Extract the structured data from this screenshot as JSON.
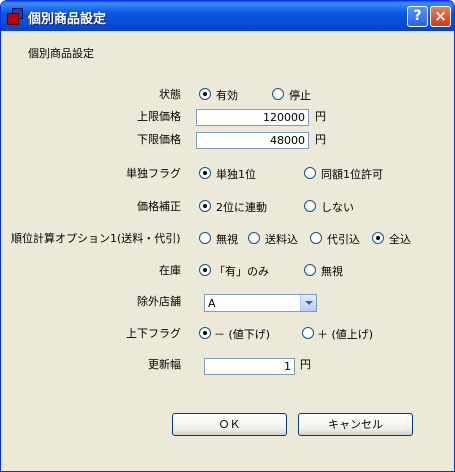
{
  "window": {
    "title": "個別商品設定",
    "help_label": "?",
    "close_label": "×"
  },
  "heading": "個別商品設定",
  "status": {
    "label": "状態",
    "options": [
      "有効",
      "停止"
    ],
    "selected": 0
  },
  "upper_price": {
    "label": "上限価格",
    "value": "120000",
    "unit": "円"
  },
  "lower_price": {
    "label": "下限価格",
    "value": "48000",
    "unit": "円"
  },
  "single_flag": {
    "label": "単独フラグ",
    "options": [
      "単独1位",
      "同額1位許可"
    ],
    "selected": 0
  },
  "price_correction": {
    "label": "価格補正",
    "options": [
      "2位に連動",
      "しない"
    ],
    "selected": 0
  },
  "rank_option": {
    "label": "順位計算オプション1(送料・代引)",
    "options": [
      "無視",
      "送料込",
      "代引込",
      "全込"
    ],
    "selected": 3
  },
  "stock": {
    "label": "在庫",
    "options": [
      "「有」のみ",
      "無視"
    ],
    "selected": 0
  },
  "exclude_store": {
    "label": "除外店舗",
    "value": "A"
  },
  "updown_flag": {
    "label": "上下フラグ",
    "options": [
      "－ (値下げ)",
      "＋ (値上げ)"
    ],
    "selected": 0
  },
  "update_width": {
    "label": "更新幅",
    "value": "1",
    "unit": "円"
  },
  "buttons": {
    "ok": "ＯＫ",
    "cancel": "キャンセル"
  }
}
